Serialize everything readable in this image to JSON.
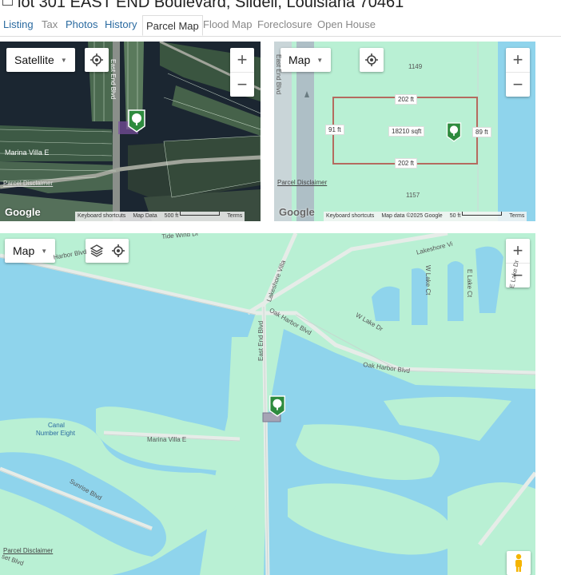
{
  "title": "lot 301 EAST END Boulevard, Slidell, Louisiana 70461",
  "tabs": [
    {
      "label": "Listing"
    },
    {
      "label": "Tax"
    },
    {
      "label": "Photos"
    },
    {
      "label": "History"
    },
    {
      "label": "Parcel Map"
    },
    {
      "label": "Flood Map"
    },
    {
      "label": "Foreclosure"
    },
    {
      "label": "Open House"
    }
  ],
  "active_tab": "Parcel Map",
  "satellite_map": {
    "type_label": "Satellite",
    "road_east_end": "East End Blvd",
    "place_marina": "Marina Villa E",
    "disclaimer": "Parcel Disclaimer",
    "logo": "Google",
    "attribution": {
      "shortcuts": "Keyboard shortcuts",
      "data": "Map Data",
      "scale": "500 ft",
      "terms": "Terms"
    }
  },
  "parcel_map": {
    "type_label": "Map",
    "road_east_end": "East End Blvd",
    "lot_north": "1149",
    "lot_south": "1157",
    "dim_top": "202 ft",
    "dim_bottom": "202 ft",
    "dim_left": "91 ft",
    "dim_right": "89 ft",
    "area": "18210 sqft",
    "disclaimer": "Parcel Disclaimer",
    "logo": "Google",
    "attribution": {
      "shortcuts": "Keyboard shortcuts",
      "data": "Map data ©2025 Google",
      "scale": "50 ft",
      "terms": "Terms"
    }
  },
  "area_map": {
    "type_label": "Map",
    "labels": {
      "tide_wind": "Tide Wind Dr",
      "harbor_blvd": "Harbor Blvd",
      "lakeshore": "Lakeshore Villa",
      "lakeshore_vi": "Lakeshore Vi",
      "oak_harbor_1": "Oak Harbor Blvd",
      "oak_harbor_2": "Oak Harbor Blvd",
      "w_lake_ct": "W Lake Ct",
      "e_lake_ct": "E Lake Ct",
      "w_lake_dr": "W Lake Dr",
      "e_lake_dr": "E Lake Dr",
      "east_end": "East End Blvd",
      "canal": "Canal",
      "canal2": "Number Eight",
      "marina": "Marina Villa E",
      "sunrise": "Sunrise Blvd",
      "sunset": "set Blvd",
      "disclaimer": "Parcel Disclaimer"
    }
  },
  "colors": {
    "land": "#b9f0d4",
    "water": "#8fd4ec",
    "parcel_line": "#b46b5f",
    "pin": "#2e8b3e",
    "link": "#2a6aa0"
  },
  "icons": {
    "locate": "crosshair-icon",
    "layers": "layers-icon",
    "pin": "tree-pin-icon",
    "pegman": "pegman-icon",
    "checkbox": "checkbox-icon"
  }
}
